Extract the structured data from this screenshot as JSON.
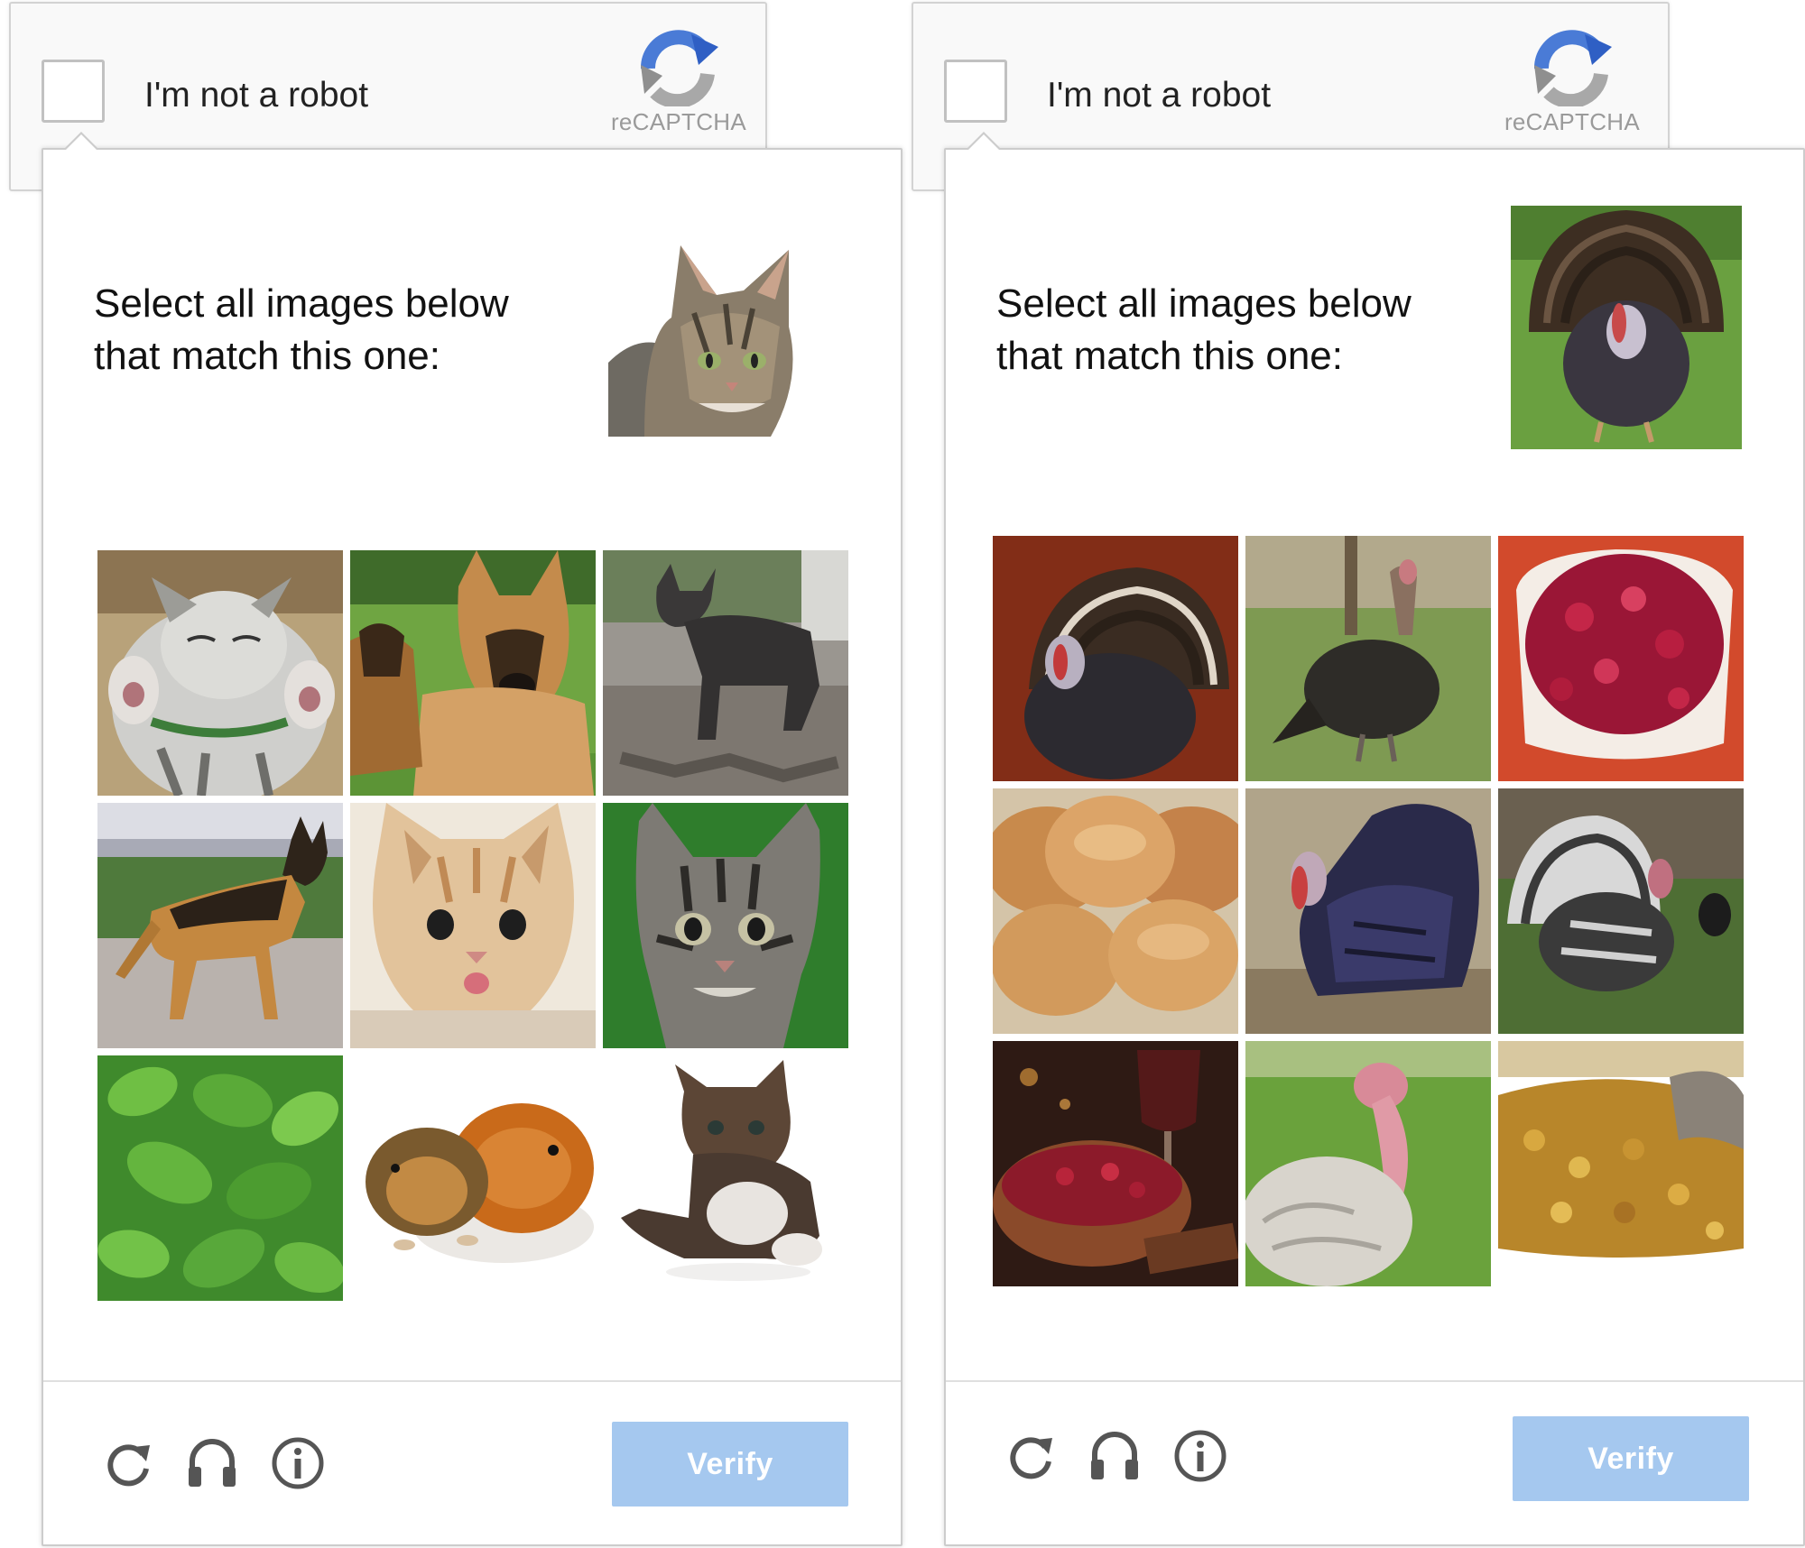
{
  "widgets": [
    {
      "anchor": {
        "label": "I'm not a robot",
        "logo_text": "reCAPTCHA",
        "logo_icon": "recaptcha-logo-icon"
      },
      "challenge": {
        "instruction_line1": "Select all images below",
        "instruction_line2": "that match this one:",
        "sample_image": "cat",
        "tiles": [
          "kitten",
          "german-shepherd-dogs",
          "dark-dog",
          "german-shepherd",
          "orange-kitten",
          "tabby-kitten",
          "green-leaves",
          "guinea-pigs",
          "fluffy-kitten"
        ]
      },
      "footer": {
        "icons": [
          "reload-icon",
          "headphones-icon",
          "info-icon"
        ],
        "verify_label": "Verify"
      }
    },
    {
      "anchor": {
        "label": "I'm not a robot",
        "logo_text": "reCAPTCHA",
        "logo_icon": "recaptcha-logo-icon"
      },
      "challenge": {
        "instruction_line1": "Select all images below",
        "instruction_line2": "that match this one:",
        "sample_image": "turkey",
        "tiles": [
          "turkey-fan",
          "turkey-grass",
          "cranberry-sauce",
          "bread-rolls",
          "turkey-dark",
          "turkey-white-fan",
          "cranberries-wine",
          "white-turkey",
          "stuffing"
        ]
      },
      "footer": {
        "icons": [
          "reload-icon",
          "headphones-icon",
          "info-icon"
        ],
        "verify_label": "Verify"
      }
    }
  ],
  "colors": {
    "verify_button": "#a5c8ef",
    "border": "#cccccc",
    "logo_blue": "#4a7bd6",
    "logo_gray": "#a8a8a8"
  }
}
